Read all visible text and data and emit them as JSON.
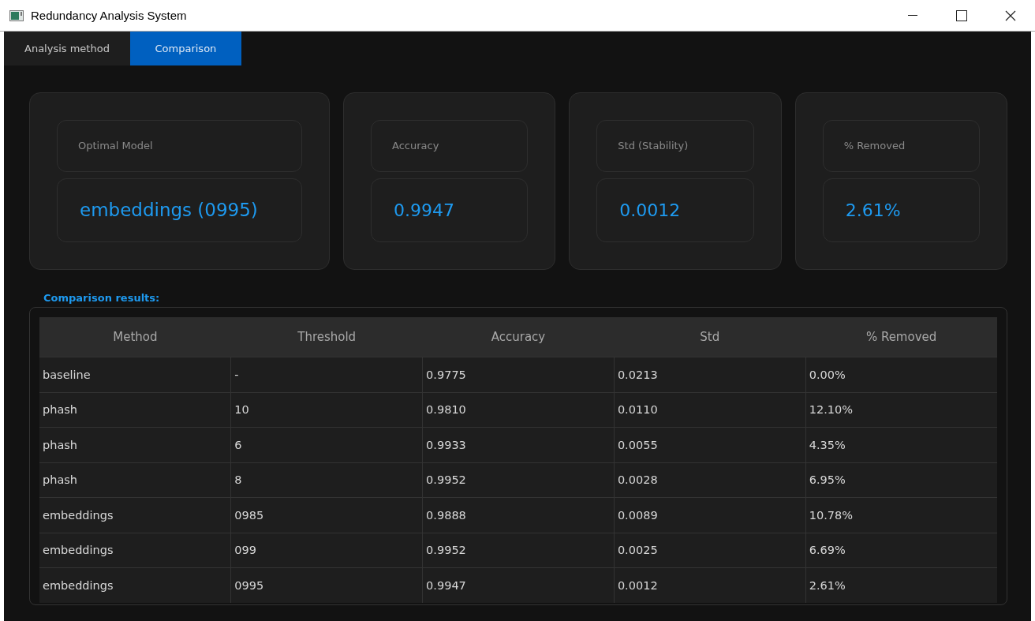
{
  "window": {
    "title": "Redundancy Analysis System"
  },
  "tabs": [
    {
      "label": "Analysis method",
      "selected": false
    },
    {
      "label": "Comparison",
      "selected": true
    }
  ],
  "summary": [
    {
      "label": "Optimal Model",
      "value": "embeddings (0995)"
    },
    {
      "label": "Accuracy",
      "value": "0.9947"
    },
    {
      "label": "Std (Stability)",
      "value": "0.0012"
    },
    {
      "label": "% Removed",
      "value": "2.61%"
    }
  ],
  "results": {
    "title": "Comparison results:",
    "columns": [
      "Method",
      "Threshold",
      "Accuracy",
      "Std",
      "% Removed"
    ],
    "rows": [
      [
        "baseline",
        "-",
        "0.9775",
        "0.0213",
        "0.00%"
      ],
      [
        "phash",
        "10",
        "0.9810",
        "0.0110",
        "12.10%"
      ],
      [
        "phash",
        "6",
        "0.9933",
        "0.0055",
        "4.35%"
      ],
      [
        "phash",
        "8",
        "0.9952",
        "0.0028",
        "6.95%"
      ],
      [
        "embeddings",
        "0985",
        "0.9888",
        "0.0089",
        "10.78%"
      ],
      [
        "embeddings",
        "099",
        "0.9952",
        "0.0025",
        "6.69%"
      ],
      [
        "embeddings",
        "0995",
        "0.9947",
        "0.0012",
        "2.61%"
      ]
    ]
  }
}
